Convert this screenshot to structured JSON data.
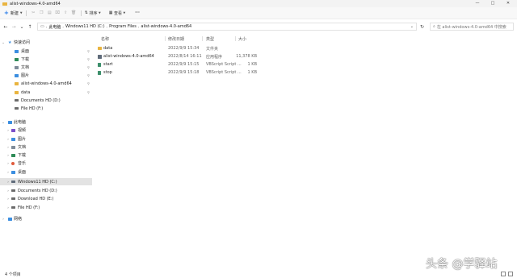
{
  "window": {
    "title": "alist-windows-4.0-amd64",
    "controls": [
      "—",
      "□",
      "✕"
    ]
  },
  "toolbar": {
    "new_label": "新建",
    "icons": [
      "cut-icon",
      "copy-icon",
      "paste-icon",
      "rename-icon",
      "share-icon",
      "delete-icon"
    ],
    "sort_label": "排序",
    "view_label": "查看",
    "more_label": "···"
  },
  "address": {
    "crumbs": [
      "此电脑",
      "Windows11 HD (C:)",
      "Program Files",
      "alist-windows-4.0-amd64"
    ],
    "search_placeholder": "在 alist-windows-4.0-amd64 中搜索"
  },
  "nav": {
    "quick_access": "快速访问",
    "quick_items": [
      {
        "label": "桌面",
        "color": "#3b8ee0"
      },
      {
        "label": "下载",
        "color": "#2e8b57"
      },
      {
        "label": "文档",
        "color": "#7f8c99"
      },
      {
        "label": "图片",
        "color": "#3b8ee0"
      },
      {
        "label": "alist-windows-4.0-amd64",
        "color": "#e9b43f"
      },
      {
        "label": "data",
        "color": "#e9b43f"
      },
      {
        "label": "Documents HD (D:)",
        "color": "#6b6b6b"
      },
      {
        "label": "File HD (F:)",
        "color": "#6b6b6b"
      }
    ],
    "this_pc": "此电脑",
    "pc_items": [
      {
        "label": "视频",
        "color": "#7b4fc9"
      },
      {
        "label": "图片",
        "color": "#3b8ee0"
      },
      {
        "label": "文档",
        "color": "#7f8c99"
      },
      {
        "label": "下载",
        "color": "#2e8b57"
      },
      {
        "label": "音乐",
        "color": "#e05a3b"
      },
      {
        "label": "桌面",
        "color": "#3b8ee0"
      },
      {
        "label": "Windows11 HD (C:)",
        "color": "#5f6b7a"
      },
      {
        "label": "Documents HD (D:)",
        "color": "#6b6b6b"
      },
      {
        "label": "Download HD (E:)",
        "color": "#6b6b6b"
      },
      {
        "label": "File HD (F:)",
        "color": "#6b6b6b"
      }
    ],
    "network": "网络"
  },
  "columns": [
    "名称",
    "修改日期",
    "类型",
    "大小"
  ],
  "files": [
    {
      "name": "data",
      "date": "2022/9/9 15:34",
      "type": "文件夹",
      "size": "",
      "kind": "folder"
    },
    {
      "name": "alist-windows-4.0-amd64",
      "date": "2022/8/14 16:11",
      "type": "应用程序",
      "size": "11,378 KB",
      "kind": "app"
    },
    {
      "name": "start",
      "date": "2022/9/9 15:15",
      "type": "VBScript Script ...",
      "size": "1 KB",
      "kind": "vbs"
    },
    {
      "name": "stop",
      "date": "2022/9/9 15:18",
      "type": "VBScript Script ...",
      "size": "1 KB",
      "kind": "vbs"
    }
  ],
  "status": {
    "count": "4 个项目"
  },
  "watermark": "头条 @学驿站"
}
